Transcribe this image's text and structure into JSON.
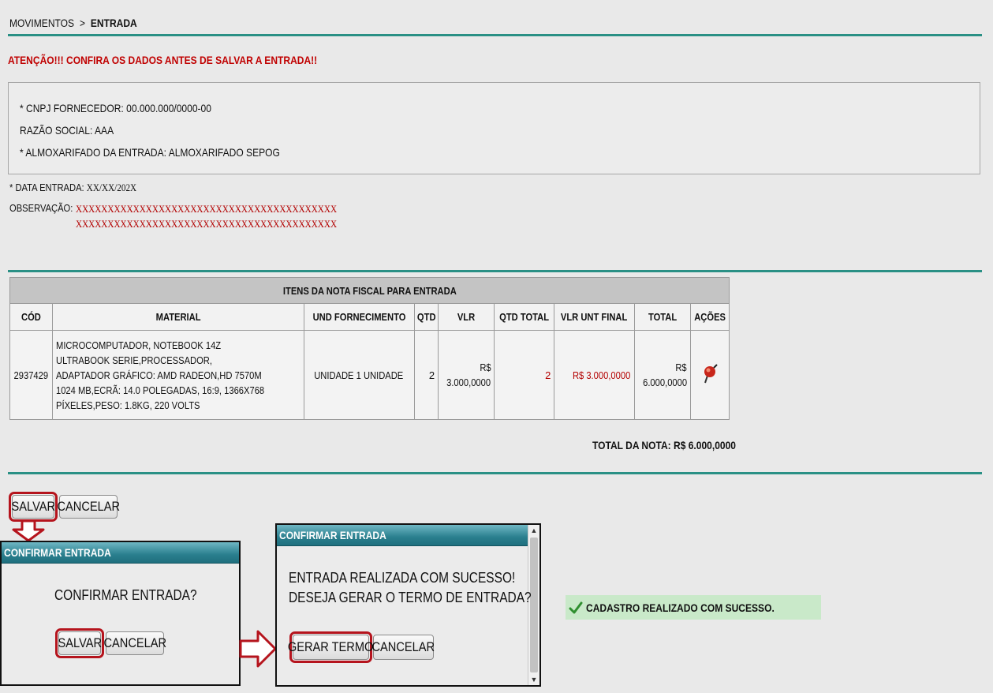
{
  "breadcrumb": {
    "section": "MOVIMENTOS",
    "separator": ">",
    "current": "ENTRADA"
  },
  "warning": "ATENÇÃO!!! CONFIRA OS DADOS ANTES DE SALVAR A ENTRADA!!",
  "supplier": {
    "cnpj_label": "* CNPJ FORNECEDOR:",
    "cnpj_value": "00.000.000/0000-00",
    "razao_label": "RAZÃO SOCIAL:",
    "razao_value": "AAA",
    "almox_label": "* ALMOXARIFADO DA ENTRADA:",
    "almox_value": "ALMOXARIFADO SEPOG"
  },
  "entry": {
    "date_label": "* DATA ENTRADA:",
    "date_value": "XX/XX/202X",
    "obs_label": "OBSERVAÇÃO:",
    "obs_line1": "XXXXXXXXXXXXXXXXXXXXXXXXXXXXXXXXXXXXXXXXX",
    "obs_line2": "XXXXXXXXXXXXXXXXXXXXXXXXXXXXXXXXXXXXXXXXX"
  },
  "items_table": {
    "caption": "ITENS DA NOTA FISCAL PARA ENTRADA",
    "headers": [
      "CÓD",
      "MATERIAL",
      "UND FORNECIMENTO",
      "QTD",
      "VLR",
      "QTD TOTAL",
      "VLR UNT FINAL",
      "TOTAL",
      "AÇÕES"
    ],
    "rows": [
      {
        "cod": "2937429",
        "material": "MICROCOMPUTADOR, NOTEBOOK 14Z ULTRABOOK SERIE,PROCESSADOR, ADAPTADOR GRÁFICO: AMD RADEON,HD 7570M 1024 MB,ECRÃ: 14.0 POLEGADAS, 16:9, 1366X768 PÍXELES,PESO: 1.8KG, 220 VOLTS",
        "und": "UNIDADE 1 UNIDADE",
        "qtd": "2",
        "vlr_currency": "R$",
        "vlr_value": "3.000,0000",
        "qtd_total": "2",
        "vlr_unt_final": "R$ 3.000,0000",
        "total_currency": "R$",
        "total_value": "6.000,0000",
        "action_icon": "pin-delete-icon"
      }
    ]
  },
  "total_nota": "TOTAL DA NOTA: R$ 6.000,0000",
  "buttons": {
    "save": "SALVAR",
    "cancel": "CANCELAR"
  },
  "confirm_dialog": {
    "title": "CONFIRMAR ENTRADA",
    "message": "CONFIRMAR ENTRADA?",
    "save": "SALVAR",
    "cancel": "CANCELAR"
  },
  "result_dialog": {
    "title": "CONFIRMAR ENTRADA",
    "line1": "ENTRADA REALIZADA COM SUCESSO!",
    "line2": "DESEJA GERAR O TERMO DE ENTRADA?",
    "generate": "GERAR TERMO",
    "cancel": "CANCELAR"
  },
  "success_message": "CADASTRO REALIZADO COM SUCESSO.",
  "colors": {
    "accent": "#2a9085",
    "warning": "#c00000",
    "highlight": "#b5141d",
    "success_bg": "#c9e9c9"
  }
}
